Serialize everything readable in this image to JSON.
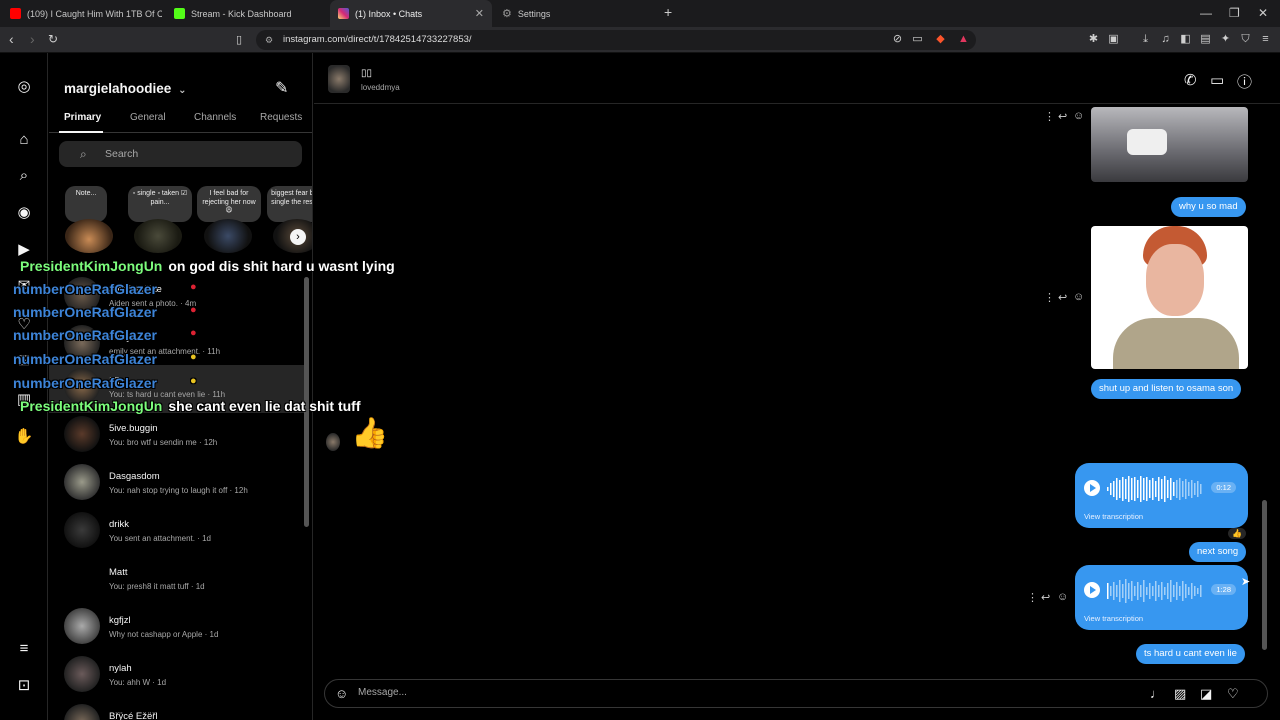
{
  "browser": {
    "tabs": [
      {
        "title": "(109) I Caught Him With 1TB Of CHI...",
        "favicon": "youtube-icon",
        "color": "#ff0000"
      },
      {
        "title": "Stream - Kick Dashboard",
        "favicon": "kick-icon",
        "color": "#53fc18"
      },
      {
        "title": "(1) Inbox • Chats",
        "favicon": "instagram-icon",
        "color": "#e1306c"
      },
      {
        "title": "Settings",
        "favicon": "gear-icon",
        "color": "#999999"
      }
    ],
    "url": "instagram.com/direct/t/17842514733227853/"
  },
  "inbox": {
    "username": "margielahoodiee",
    "tabs": [
      "Primary",
      "General",
      "Channels",
      "Requests"
    ],
    "search_placeholder": "Search",
    "notes": [
      {
        "text": "Note..."
      },
      {
        "text": "▫ single ▫ taken ☑ pain..."
      },
      {
        "text": "I feel bad for rejecting her now😩"
      },
      {
        "text": "biggest fear being single the rest of r"
      }
    ],
    "conversations": [
      {
        "name": "Äiðeñ Mëjiæ",
        "sub": "Aiden sent a photo. · 4m"
      },
      {
        "name": "emily",
        "sub": "emily sent an attachment. · 11h"
      },
      {
        "name": "▯▯",
        "sub": "You: ts hard u cant even lie · 11h"
      },
      {
        "name": "5ive.buggin",
        "sub": "You: bro wtf u sendin me · 12h"
      },
      {
        "name": "Dasgasdom",
        "sub": "You: nah stop trying to laugh it off · 12h"
      },
      {
        "name": "drikk",
        "sub": "You sent an attachment. · 1d"
      },
      {
        "name": "Matt",
        "sub": "You: presh8 it matt tuff · 1d"
      },
      {
        "name": "kgfjzl",
        "sub": "Why not cashapp or Apple · 1d"
      },
      {
        "name": "nylah",
        "sub": "You: ahh W · 1d"
      },
      {
        "name": "Břÿcé Ežëřl",
        "sub": ""
      }
    ]
  },
  "chat": {
    "name": "▯▯",
    "handle": "loveddmya",
    "messages": {
      "m1": "why u so mad",
      "m2": "shut up and listen to osama son",
      "voice1_duration": "0:12",
      "voice2_duration": "1:28",
      "view_transcription": "View transcription",
      "m3": "next song",
      "m4": "ts hard u cant even lie"
    },
    "reaction": "👍",
    "composer_placeholder": "Message..."
  },
  "overlay": [
    {
      "user": "PresidentKimJongUn",
      "msg": "on god dis shit hard u wasnt lying"
    },
    {
      "user": "numberOneRafGlazer",
      "msg": ""
    },
    {
      "user": "numberOneRafGlazer",
      "msg": ""
    },
    {
      "user": "numberOneRafGlazer",
      "msg": ""
    },
    {
      "user": "numberOneRafGlazer",
      "msg": ""
    },
    {
      "user": "numberOneRafGlazer",
      "msg": ""
    },
    {
      "user": "PresidentKimJongUn",
      "msg": "she cant even lie dat shit tuff"
    }
  ],
  "colors": {
    "accent": "#3797f0",
    "bg": "#000000",
    "overlay_user_green": "#7CFC7C",
    "overlay_user_blue": "#3d84d8"
  }
}
